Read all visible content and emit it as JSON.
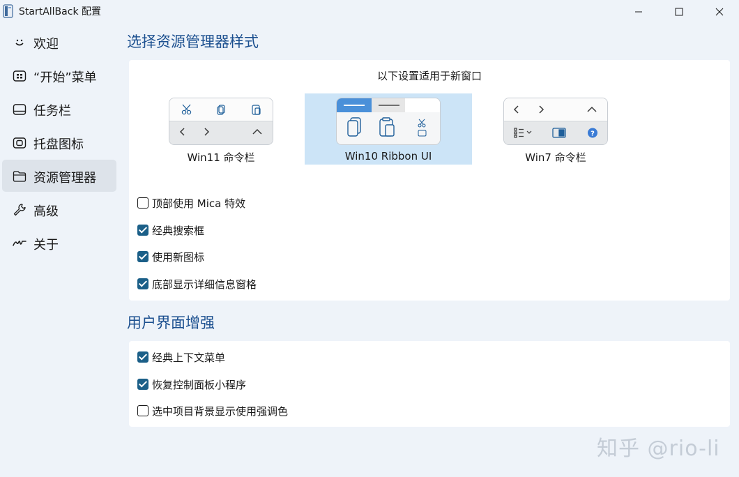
{
  "window": {
    "title": "StartAllBack 配置"
  },
  "sidebar": {
    "items": [
      {
        "label": "欢迎",
        "icon": "smile-icon",
        "selected": false
      },
      {
        "label": "“开始”菜单",
        "icon": "start-menu-icon",
        "selected": false
      },
      {
        "label": "任务栏",
        "icon": "taskbar-icon",
        "selected": false
      },
      {
        "label": "托盘图标",
        "icon": "tray-icon",
        "selected": false
      },
      {
        "label": "资源管理器",
        "icon": "folder-icon",
        "selected": true
      },
      {
        "label": "高级",
        "icon": "wrench-icon",
        "selected": false
      },
      {
        "label": "关于",
        "icon": "signature-icon",
        "selected": false
      }
    ]
  },
  "explorer_style": {
    "title": "选择资源管理器样式",
    "caption": "以下设置适用于新窗口",
    "options": [
      {
        "label": "Win11 命令栏",
        "selected": false
      },
      {
        "label": "Win10 Ribbon UI",
        "selected": true
      },
      {
        "label": "Win7 命令栏",
        "selected": false
      }
    ],
    "checkboxes": [
      {
        "label": "顶部使用 Mica 特效",
        "checked": false
      },
      {
        "label": "经典搜索框",
        "checked": true
      },
      {
        "label": "使用新图标",
        "checked": true
      },
      {
        "label": "底部显示详细信息窗格",
        "checked": true
      }
    ]
  },
  "ui_enhance": {
    "title": "用户界面增强",
    "checkboxes": [
      {
        "label": "经典上下文菜单",
        "checked": true
      },
      {
        "label": "恢复控制面板小程序",
        "checked": true
      },
      {
        "label": "选中项目背景显示使用强调色",
        "checked": false
      }
    ]
  },
  "watermark": "知乎 @rio-li",
  "colors": {
    "accent": "#1b5f88",
    "section_title": "#1b4f8f",
    "selection": "#cce4f7",
    "background": "#eef3f9"
  }
}
